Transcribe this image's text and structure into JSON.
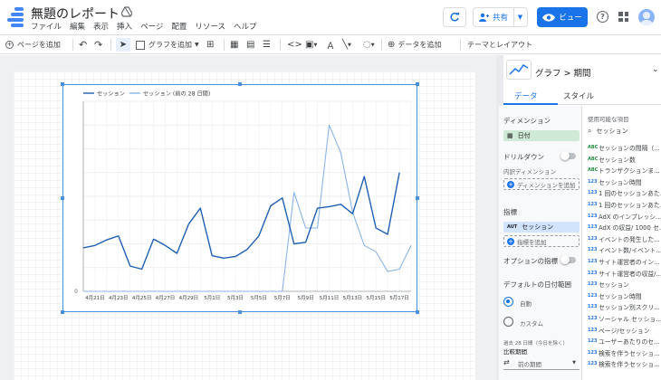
{
  "app": {
    "title": "無題のレポート",
    "menus": [
      "ファイル",
      "編集",
      "表示",
      "挿入",
      "ページ",
      "配置",
      "リソース",
      "ヘルプ"
    ],
    "share_label": "共有",
    "view_label": "ビュー",
    "help_label": "?"
  },
  "toolbar": {
    "add_page": "ページを追加",
    "add_chart": "グラフを追加",
    "add_data": "データを追加",
    "theme_layout": "テーマとレイアウト"
  },
  "chart_data": {
    "type": "line",
    "legend_position": "top-left",
    "grid": true,
    "x": [
      "4月20日",
      "4月21日",
      "4月22日",
      "4月23日",
      "4月24日",
      "4月25日",
      "4月26日",
      "4月27日",
      "4月28日",
      "4月29日",
      "4月30日",
      "5月1日",
      "5月2日",
      "5月3日",
      "5月4日",
      "5月5日",
      "5月6日",
      "5月7日",
      "5月8日",
      "5月9日",
      "5月10日",
      "5月11日",
      "5月12日",
      "5月13日",
      "5月14日",
      "5月15日",
      "5月16日",
      "5月17日",
      "5月18日"
    ],
    "x_tick_labels": [
      "4月21日",
      "4月23日",
      "4月25日",
      "4月27日",
      "4月29日",
      "5月1日",
      "5月3日",
      "5月5日",
      "5月7日",
      "5月9日",
      "5月11日",
      "5月13日",
      "5月15日",
      "5月17日"
    ],
    "y_tick_labels": [
      "0"
    ],
    "ylim": [
      0,
      240
    ],
    "series": [
      {
        "name": "セッション",
        "color": "#1f5fb4",
        "values": [
          55,
          58,
          65,
          70,
          32,
          28,
          66,
          58,
          48,
          85,
          105,
          45,
          42,
          44,
          53,
          70,
          108,
          118,
          60,
          62,
          105,
          107,
          110,
          98,
          145,
          80,
          72,
          150
        ]
      },
      {
        "name": "セッション (前の 28 日間)",
        "color": "#8ab4e8",
        "values": [
          0,
          0,
          0,
          0,
          0,
          0,
          0,
          0,
          0,
          0,
          0,
          0,
          0,
          0,
          0,
          0,
          0,
          0,
          125,
          80,
          80,
          210,
          175,
          100,
          58,
          50,
          25,
          28,
          58
        ]
      }
    ]
  },
  "panel": {
    "chart_type_label": "グラフ",
    "chart_subtype": "期間",
    "tabs": [
      "データ",
      "スタイル"
    ],
    "dimension_heading": "ディメンション",
    "dimension_value": "日付",
    "drilldown_label": "ドリルダウン",
    "breakdown_heading": "内訳ディメンション",
    "add_dimension": "ディメンションを追加",
    "metric_heading": "指標",
    "metric_value": "セッション",
    "metric_badge": "AUT",
    "add_metric": "指標を追加",
    "optional_metrics": "オプションの指標",
    "default_date_heading": "デフォルトの日付範囲",
    "auto_label": "自動",
    "custom_label": "カスタム",
    "date_note": "過去 28 日間（今日を除く）",
    "comparison_label": "比較期間",
    "previous_period": "前の期間",
    "available_fields_heading": "使用可能な項目",
    "search_value": "セッション",
    "fields": [
      {
        "type": "ABC",
        "name": "セッションの間隔（..."
      },
      {
        "type": "ABC",
        "name": "セッション数"
      },
      {
        "type": "ABC",
        "name": "トランザクションま..."
      },
      {
        "type": "123",
        "name": "セッション時間"
      },
      {
        "type": "123",
        "name": "1 回のセッションあた..."
      },
      {
        "type": "123",
        "name": "1 回のセッションあた..."
      },
      {
        "type": "123",
        "name": "AdX のインプレッシ..."
      },
      {
        "type": "123",
        "name": "AdX の収益/ 1000 セ..."
      },
      {
        "type": "123",
        "name": "イベントの発生した..."
      },
      {
        "type": "123",
        "name": "イベント数/イベント..."
      },
      {
        "type": "123",
        "name": "サイト運営者のイン..."
      },
      {
        "type": "123",
        "name": "サイト運営者の収益/..."
      },
      {
        "type": "123",
        "name": "セッション"
      },
      {
        "type": "123",
        "name": "セッション時間"
      },
      {
        "type": "123",
        "name": "セッション別スクリ..."
      },
      {
        "type": "123",
        "name": "ソーシャル セッショ..."
      },
      {
        "type": "123",
        "name": "ページ/セッション"
      },
      {
        "type": "123",
        "name": "ユーザーあたりのセ..."
      },
      {
        "type": "123",
        "name": "検索を伴うセッショ..."
      },
      {
        "type": "123",
        "name": "検索を伴うセッショ..."
      }
    ]
  }
}
